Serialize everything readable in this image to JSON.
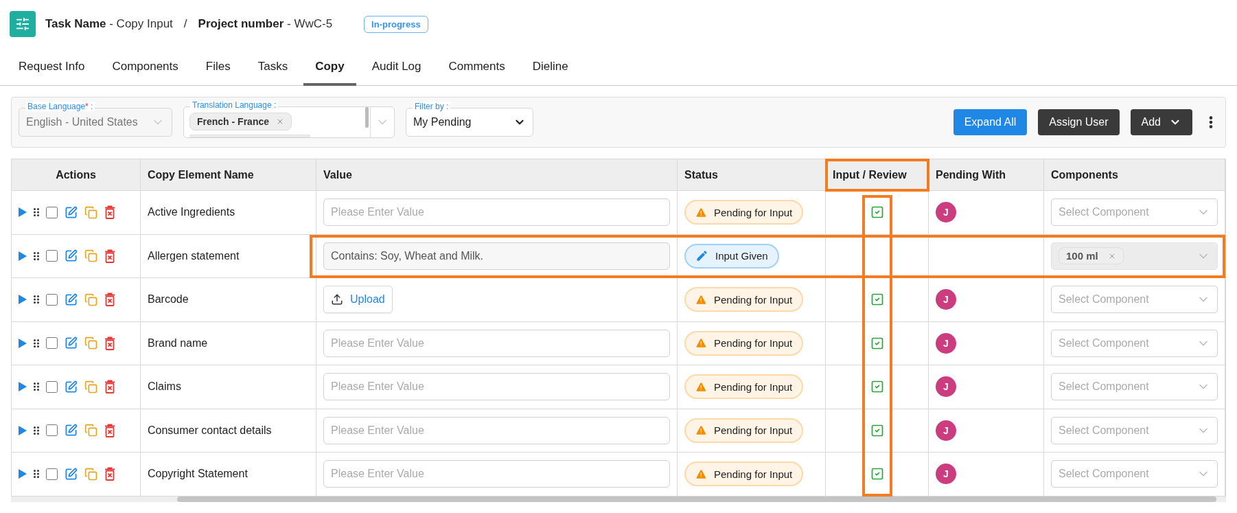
{
  "header": {
    "task_title": "**Task Name** - Copy Input",
    "separator": "/",
    "project_title": "**Project number** - WwC-5",
    "status": "In-progress"
  },
  "tabs": [
    {
      "label": "Request Info",
      "selected": false
    },
    {
      "label": "Components",
      "selected": false
    },
    {
      "label": "Files",
      "selected": false
    },
    {
      "label": "Tasks",
      "selected": false
    },
    {
      "label": "Copy",
      "selected": true
    },
    {
      "label": "Audit Log",
      "selected": false
    },
    {
      "label": "Comments",
      "selected": false
    },
    {
      "label": "Dieline",
      "selected": false
    }
  ],
  "filters": {
    "base_language": {
      "label": "Base Language",
      "required_mark": "*",
      "suffix": ":",
      "value": "English - United States",
      "disabled": true
    },
    "translation_language": {
      "label": "Translation Language :",
      "tags": [
        "French - France"
      ]
    },
    "filter_by": {
      "label": "Filter by :",
      "value": "My Pending"
    }
  },
  "actions": [
    {
      "label": "Expand All",
      "kind": "primary"
    },
    {
      "label": "Assign User",
      "kind": "dark"
    },
    {
      "label": "Add",
      "kind": "dropdown"
    }
  ],
  "table": {
    "columns": [
      {
        "label": "Actions",
        "highlighted": false
      },
      {
        "label": "Copy Element Name",
        "highlighted": false
      },
      {
        "label": "Value",
        "highlighted": false
      },
      {
        "label": "Status",
        "highlighted": false
      },
      {
        "label": "Input / Review",
        "highlighted": true
      },
      {
        "label": "Pending With",
        "highlighted": false
      },
      {
        "label": "Components",
        "highlighted": false
      }
    ],
    "rows": [
      {
        "checked": false,
        "name": "Active Ingredients",
        "value": {
          "kind": "input",
          "placeholder": "Please Enter Value"
        },
        "status": {
          "kind": "pending",
          "label": "Pending for Input"
        },
        "reviewed": true,
        "pending_with": {
          "initial": "J",
          "color": "#cc3d7f"
        },
        "components": {
          "placeholder": "Select Component",
          "disabled": false
        },
        "highlighted": false
      },
      {
        "checked": false,
        "name": "Allergen statement",
        "value": {
          "kind": "input",
          "text": "Contains: Soy, Wheat and Milk."
        },
        "status": {
          "kind": "given",
          "label": "Input Given"
        },
        "reviewed": false,
        "components": {
          "tags": [
            "100 ml"
          ],
          "disabled": true
        },
        "highlighted": true
      },
      {
        "checked": false,
        "name": "Barcode",
        "value": {
          "kind": "upload",
          "label": "Upload"
        },
        "status": {
          "kind": "pending",
          "label": "Pending for Input"
        },
        "reviewed": true,
        "pending_with": {
          "initial": "J",
          "color": "#cc3d7f"
        },
        "components": {
          "placeholder": "Select Component",
          "disabled": false
        },
        "highlighted": false
      },
      {
        "checked": false,
        "name": "Brand name",
        "value": {
          "kind": "input",
          "placeholder": "Please Enter Value"
        },
        "status": {
          "kind": "pending",
          "label": "Pending for Input"
        },
        "reviewed": true,
        "pending_with": {
          "initial": "J",
          "color": "#cc3d7f"
        },
        "components": {
          "placeholder": "Select Component",
          "disabled": false
        },
        "highlighted": false
      },
      {
        "checked": false,
        "name": "Claims",
        "value": {
          "kind": "input",
          "placeholder": "Please Enter Value"
        },
        "status": {
          "kind": "pending",
          "label": "Pending for Input"
        },
        "reviewed": true,
        "pending_with": {
          "initial": "J",
          "color": "#cc3d7f"
        },
        "components": {
          "placeholder": "Select Component",
          "disabled": false
        },
        "highlighted": false
      },
      {
        "checked": false,
        "name": "Consumer contact details",
        "value": {
          "kind": "input",
          "placeholder": "Please Enter Value"
        },
        "status": {
          "kind": "pending",
          "label": "Pending for Input"
        },
        "reviewed": true,
        "pending_with": {
          "initial": "J",
          "color": "#cc3d7f"
        },
        "components": {
          "placeholder": "Select Component",
          "disabled": false
        },
        "highlighted": false
      },
      {
        "checked": false,
        "name": "Copyright Statement",
        "value": {
          "kind": "input",
          "placeholder": "Please Enter Value"
        },
        "status": {
          "kind": "pending",
          "label": "Pending for Input"
        },
        "reviewed": true,
        "pending_with": {
          "initial": "J",
          "color": "#cc3d7f"
        },
        "components": {
          "placeholder": "Select Component",
          "disabled": false
        },
        "highlighted": false
      }
    ]
  }
}
